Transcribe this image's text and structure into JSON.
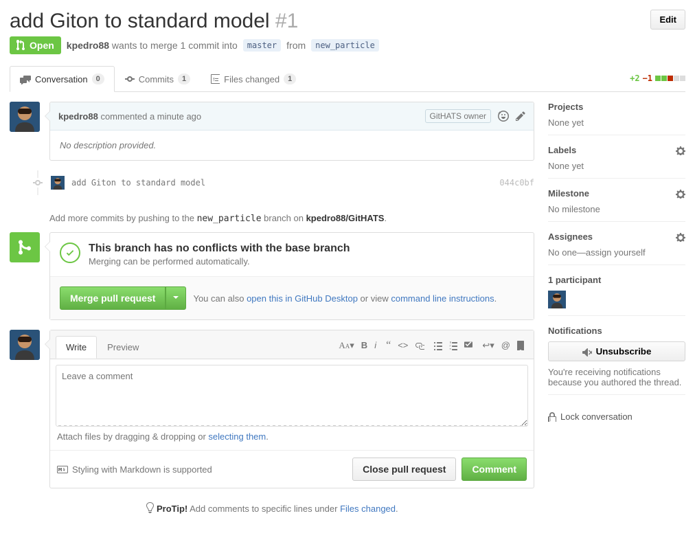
{
  "title": "add Giton to standard model",
  "pr_number": "#1",
  "edit_label": "Edit",
  "state": "Open",
  "author": "kpedro88",
  "meta_text": "wants to merge 1 commit into",
  "base_branch": "master",
  "from_text": "from",
  "head_branch": "new_particle",
  "tabs": {
    "conversation": {
      "label": "Conversation",
      "count": "0"
    },
    "commits": {
      "label": "Commits",
      "count": "1"
    },
    "files": {
      "label": "Files changed",
      "count": "1"
    }
  },
  "diff_add": "+2",
  "diff_del": "−1",
  "comment": {
    "author": "kpedro88",
    "time": "commented a minute ago",
    "owner_badge": "GitHATS owner",
    "body": "No description provided."
  },
  "commit": {
    "message": "add Giton to standard model",
    "sha": "044c0bf"
  },
  "push_hint_pre": "Add more commits by pushing to the ",
  "push_hint_branch": "new_particle",
  "push_hint_mid": " branch on ",
  "push_hint_repo": "kpedro88/GitHATS",
  "merge": {
    "status_title": "This branch has no conflicts with the base branch",
    "status_sub": "Merging can be performed automatically.",
    "button": "Merge pull request",
    "hint_pre": "You can also ",
    "hint_link1": "open this in GitHub Desktop",
    "hint_mid": " or view ",
    "hint_link2": "command line instructions"
  },
  "write": {
    "tab_write": "Write",
    "tab_preview": "Preview",
    "placeholder": "Leave a comment",
    "attach_pre": "Attach files by dragging & dropping or ",
    "attach_link": "selecting them",
    "md_hint": "Styling with Markdown is supported",
    "close_btn": "Close pull request",
    "comment_btn": "Comment"
  },
  "protip_label": "ProTip!",
  "protip_text": " Add comments to specific lines under ",
  "protip_link": "Files changed",
  "sidebar": {
    "projects": {
      "title": "Projects",
      "value": "None yet"
    },
    "labels": {
      "title": "Labels",
      "value": "None yet"
    },
    "milestone": {
      "title": "Milestone",
      "value": "No milestone"
    },
    "assignees": {
      "title": "Assignees",
      "value": "No one—assign yourself"
    },
    "participants": "1 participant",
    "notifications": {
      "title": "Notifications",
      "unsubscribe": "Unsubscribe",
      "reason": "You're receiving notifications because you authored the thread."
    },
    "lock": "Lock conversation"
  }
}
